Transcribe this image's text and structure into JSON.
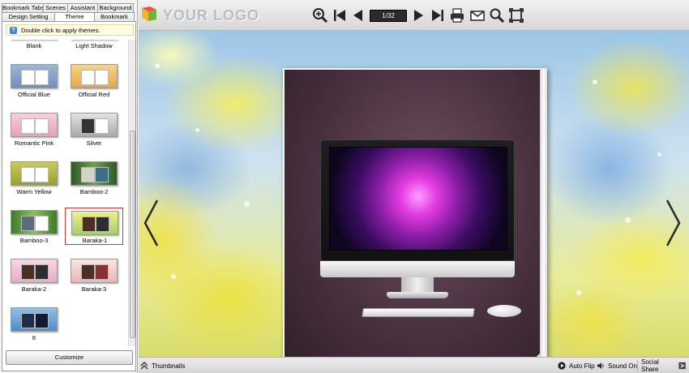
{
  "left_panel": {
    "tabs_row1": [
      "Bookmark Tabs",
      "Scenes",
      "Assistant",
      "Background"
    ],
    "tabs_row2": [
      "Design Setting",
      "Theme",
      "Bookmark"
    ],
    "active_tab": "Theme",
    "hint": "Double click to apply themes.",
    "themes": [
      {
        "label": "Blank"
      },
      {
        "label": "Light Shadow"
      },
      {
        "label": "Official Blue"
      },
      {
        "label": "Official Red"
      },
      {
        "label": "Romantic Pink"
      },
      {
        "label": "Silver"
      },
      {
        "label": "Warm Yellow"
      },
      {
        "label": "Bamboo-2"
      },
      {
        "label": "Bamboo-3"
      },
      {
        "label": "Baraka-1"
      },
      {
        "label": "Baraka-2"
      },
      {
        "label": "Baraka-3"
      },
      {
        "label": "tt"
      }
    ],
    "selected_theme": "Baraka-1",
    "customize_label": "Customize"
  },
  "toolbar": {
    "logo_text": "YOUR LOGO",
    "page_indicator": "1/32",
    "icons": [
      "zoom-in-icon",
      "first-page-icon",
      "previous-page-icon",
      "next-page-icon",
      "last-page-icon",
      "print-icon",
      "email-icon",
      "search-icon",
      "fullscreen-icon"
    ]
  },
  "bottom_bar": {
    "thumbnails": "Thumbnails",
    "auto_flip": "Auto Flip",
    "sound_on": "Sound On",
    "social_share": "Social Share"
  },
  "colors": {
    "accent_selection": "#c43a3a",
    "page_indicator_bg": "#2a2a2a",
    "book_background": "#4a3140"
  }
}
